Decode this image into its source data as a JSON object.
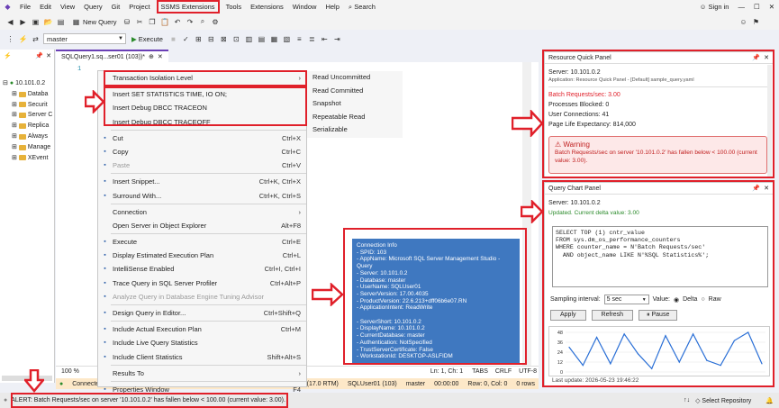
{
  "menu": [
    "File",
    "Edit",
    "View",
    "Query",
    "Git",
    "Project",
    "SSMS Extensions",
    "Tools",
    "Extensions",
    "Window",
    "Help"
  ],
  "search_label": "Search",
  "sign_in": "Sign in",
  "toolbar": {
    "new_query": "New Query",
    "database": "master",
    "execute": "Execute"
  },
  "explorer": {
    "server": "10.101.0.2",
    "nodes": [
      "Databa",
      "Securit",
      "Server C",
      "Replica",
      "Always",
      "Manage",
      "XEvent"
    ]
  },
  "query_tab": "SQLQuery1.sq...ser01 (103))*",
  "line_number": "1",
  "context_menu": {
    "items": [
      {
        "label": "Transaction Isolation Level",
        "shortcut": "",
        "submenu": true
      },
      {
        "label": "Insert SET STATISTICS TIME, IO ON;",
        "shortcut": ""
      },
      {
        "label": "Insert Debug DBCC TRACEON",
        "shortcut": ""
      },
      {
        "label": "Insert Debug DBCC TRACEOFF",
        "shortcut": ""
      },
      {
        "label": "Cut",
        "shortcut": "Ctrl+X",
        "icon": "cut-icon"
      },
      {
        "label": "Copy",
        "shortcut": "Ctrl+C",
        "icon": "copy-icon"
      },
      {
        "label": "Paste",
        "shortcut": "Ctrl+V",
        "icon": "paste-icon",
        "disabled": true
      },
      {
        "label": "Insert Snippet...",
        "shortcut": "Ctrl+K, Ctrl+X",
        "icon": "snippet-icon"
      },
      {
        "label": "Surround With...",
        "shortcut": "Ctrl+K, Ctrl+S",
        "icon": "surround-icon"
      },
      {
        "label": "Connection",
        "shortcut": "",
        "submenu": true
      },
      {
        "label": "Open Server in Object Explorer",
        "shortcut": "Alt+F8"
      },
      {
        "label": "Execute",
        "shortcut": "Ctrl+E",
        "icon": "execute-icon"
      },
      {
        "label": "Display Estimated Execution Plan",
        "shortcut": "Ctrl+L",
        "icon": "plan-icon"
      },
      {
        "label": "IntelliSense Enabled",
        "shortcut": "Ctrl+I, Ctrl+I",
        "icon": "intellisense-icon"
      },
      {
        "label": "Trace Query in SQL Server Profiler",
        "shortcut": "Ctrl+Alt+P",
        "icon": "profiler-icon"
      },
      {
        "label": "Analyze Query in Database Engine Tuning Advisor",
        "shortcut": "",
        "icon": "tuning-icon",
        "disabled": true
      },
      {
        "label": "Design Query in Editor...",
        "shortcut": "Ctrl+Shift+Q",
        "icon": "design-icon"
      },
      {
        "label": "Include Actual Execution Plan",
        "shortcut": "Ctrl+M",
        "icon": "actual-plan-icon"
      },
      {
        "label": "Include Live Query Statistics",
        "shortcut": "",
        "icon": "live-stats-icon"
      },
      {
        "label": "Include Client Statistics",
        "shortcut": "Shift+Alt+S",
        "icon": "client-stats-icon"
      },
      {
        "label": "Results To",
        "shortcut": "",
        "submenu": true
      },
      {
        "label": "Properties Window",
        "shortcut": "F4",
        "icon": "properties-icon"
      },
      {
        "label": "Query Options...",
        "shortcut": "",
        "icon": "options-icon"
      }
    ],
    "submenu": [
      "Read Uncommitted",
      "Read Committed",
      "Snapshot",
      "Repeatable Read",
      "Serializable"
    ]
  },
  "connection_info": {
    "title": "Connection Info",
    "lines": [
      "- SPID: 103",
      "- AppName: Microsoft SQL Server Management Studio - Query",
      "- Server: 10.101.0.2",
      "- Database: master",
      "- UserName: SQLUser01",
      "- ServerVersion: 17.00.4035",
      "- ProductVersion: 22.6.213+dff06b6e07.RN",
      "- ApplicationIntent: ReadWrite",
      "",
      "- ServerShort: 10.101.0.2",
      "- DisplayName: 10.101.0.2",
      "- CurrentDatabase: master",
      "- Authentication: NotSpecified",
      "- TrustServerCertificate: False",
      "- WorkstationId: DESKTOP-ASLFIDM"
    ]
  },
  "editor_status": {
    "zoom": "100 %",
    "position": "Ln: 1, Ch: 1",
    "tabs": "TABS",
    "crlf": "CRLF",
    "enc": "UTF-8"
  },
  "query_status": {
    "connected": "Connecte",
    "server": "10.101.0.2 (17.0 RTM)",
    "user": "SQLUser01 (103)",
    "db": "master",
    "time": "00:00:00",
    "rows": "Row: 0, Col: 0",
    "rows_label": "0 rows"
  },
  "resource_panel": {
    "title": "Resource Quick Panel",
    "server": "Server: 10.101.0.2",
    "app": "Application: Resource Quick Panel - [Default] sample_query.yaml",
    "batch": "Batch Requests/sec: 3.00",
    "blocked": "Processes Blocked: 0",
    "connections": "User Connections: 41",
    "ple": "Page Life Expectancy: 814,000",
    "warning_title": "Warning",
    "warning_text": "Batch Requests/sec on server '10.101.0.2' has fallen below < 100.00 (current value: 3.00)."
  },
  "chart_panel": {
    "title": "Query Chart Panel",
    "server": "Server: 10.101.0.2",
    "updated": "Updated. Current delta value: 3.00",
    "sql": "SELECT TOP (1) cntr_value\nFROM sys.dm_os_performance_counters\nWHERE counter_name = N'Batch Requests/sec'\n  AND object_name LIKE N'%SQL Statistics%';",
    "sampling_label": "Sampling interval:",
    "sampling_value": "5 sec",
    "value_label": "Value:",
    "delta": "Delta",
    "raw": "Raw",
    "apply": "Apply",
    "refresh": "Refresh",
    "pause": "Pause",
    "last_update": "Last update: 2026-05-23 19:46:22"
  },
  "chart_data": {
    "type": "line",
    "ylim": [
      0,
      48
    ],
    "yticks": [
      "48",
      "36",
      "24",
      "12",
      "0"
    ],
    "values": [
      30,
      8,
      42,
      10,
      46,
      22,
      4,
      44,
      12,
      46,
      14,
      8,
      38,
      48,
      10
    ]
  },
  "alert": "ALERT: Batch Requests/sec on server '10.101.0.2' has fallen below < 100.00 (current value: 3.00).",
  "select_repository": "Select Repository"
}
